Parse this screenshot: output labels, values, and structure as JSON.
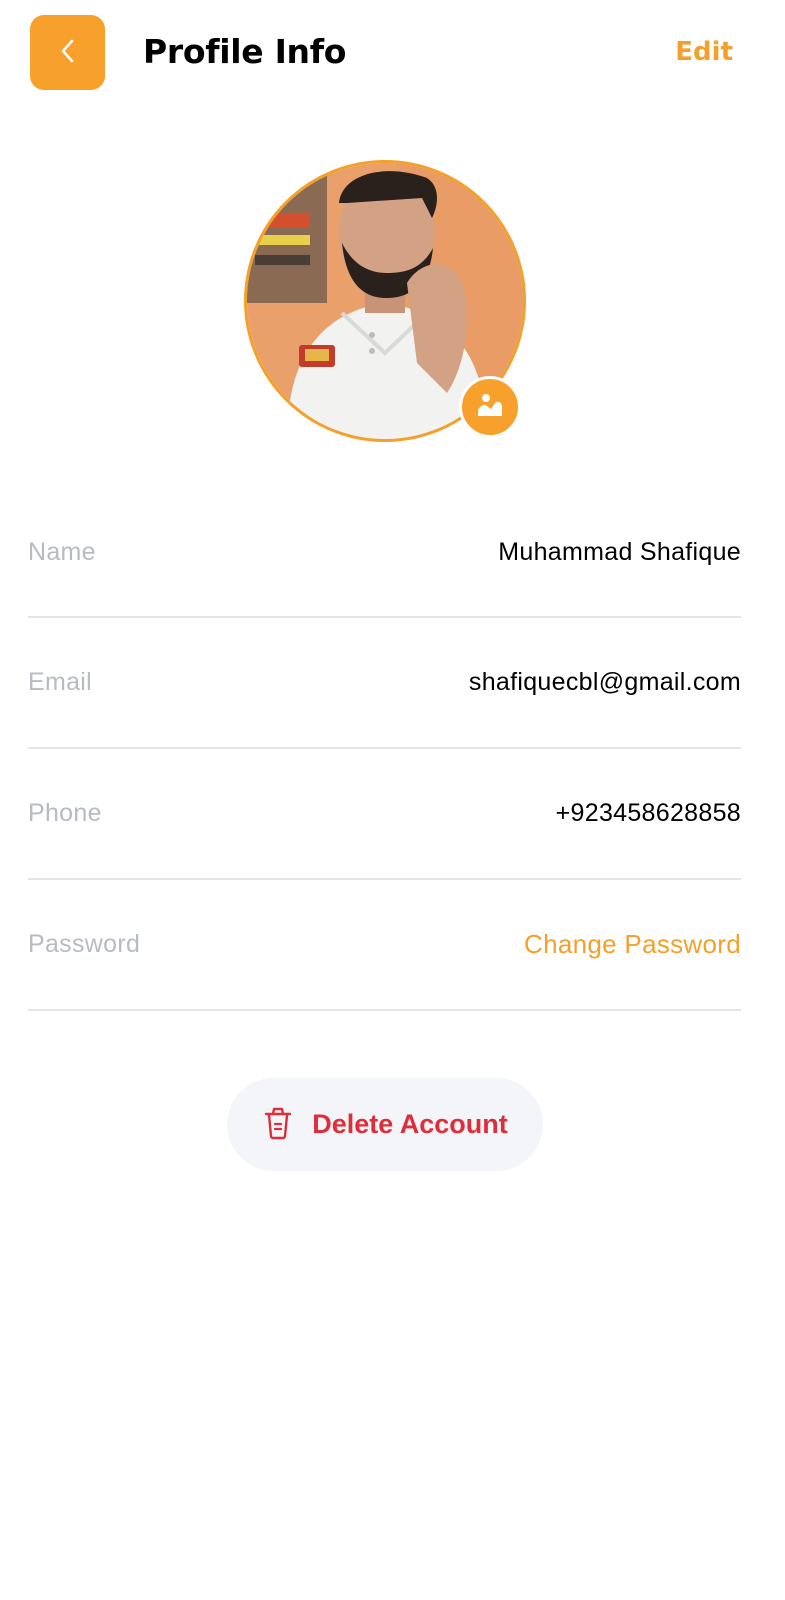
{
  "header": {
    "title": "Profile Info",
    "edit_label": "Edit",
    "back_icon": "chevron-left-icon"
  },
  "profile": {
    "avatar_icon": "avatar",
    "change_photo_icon": "image-icon"
  },
  "fields": [
    {
      "label": "Name",
      "value": "Muhammad Shafique"
    },
    {
      "label": "Email",
      "value": "shafiquecbl@gmail.com"
    },
    {
      "label": "Phone",
      "value": "+923458628858"
    },
    {
      "label": "Password",
      "value": "Change Password"
    }
  ],
  "actions": {
    "delete_label": "Delete Account",
    "delete_icon": "trash-icon"
  },
  "colors": {
    "accent": "#f7a12c",
    "danger": "#df2d3b",
    "muted_label": "#b7bbc2",
    "divider": "#e4e5e8",
    "pill_background": "#f4f5f8"
  }
}
